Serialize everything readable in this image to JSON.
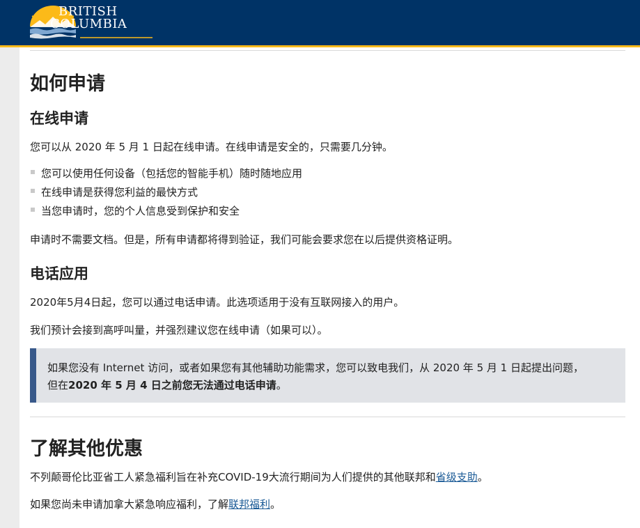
{
  "header": {
    "logo_line1": "BRITISH",
    "logo_line2": "COLUMBIA"
  },
  "content": {
    "title": "如何申请",
    "online": {
      "heading": "在线申请",
      "intro": "您可以从 2020 年 5 月 1 日起在线申请。在线申请是安全的，只需要几分钟。",
      "bullets": [
        "您可以使用任何设备（包括您的智能手机）随时随地应用",
        "在线申请是获得您利益的最快方式",
        "当您申请时，您的个人信息受到保护和安全"
      ],
      "note": "申请时不需要文档。但是，所有申请都将得到验证，我们可能会要求您在以后提供资格证明。"
    },
    "phone": {
      "heading": "电话应用",
      "p1": "2020年5月4日起，您可以通过电话申请。此选项适用于没有互联网接入的用户。",
      "p2": "我们预计会接到高呼叫量，并强烈建议您在线申请（如果可以）。",
      "callout_line1": "如果您没有 Internet 访问，或者如果您有其他辅助功能需求，您可以致电我们，从 2020 年 5 月 1 日起提出问题，",
      "callout_line2_prefix": "但在",
      "callout_line2_bold": "2020 年 5 月 4 日之前您无法通过电话申请",
      "callout_line2_suffix": "。"
    },
    "other": {
      "heading": "了解其他优惠",
      "p1_text": "不列颠哥伦比亚省工人紧急福利旨在补充COVID-19大流行期间为人们提供的其他联邦和",
      "p1_link": "省级支助",
      "p1_end": "。",
      "p2_text": "如果您尚未申请加拿大紧急响应福利，了解",
      "p2_link": "联邦福利",
      "p2_end": "。"
    }
  },
  "colors": {
    "header_bg": "#003366",
    "header_accent": "#fcba19",
    "callout_bar": "#38598a",
    "link": "#1a5a96"
  }
}
